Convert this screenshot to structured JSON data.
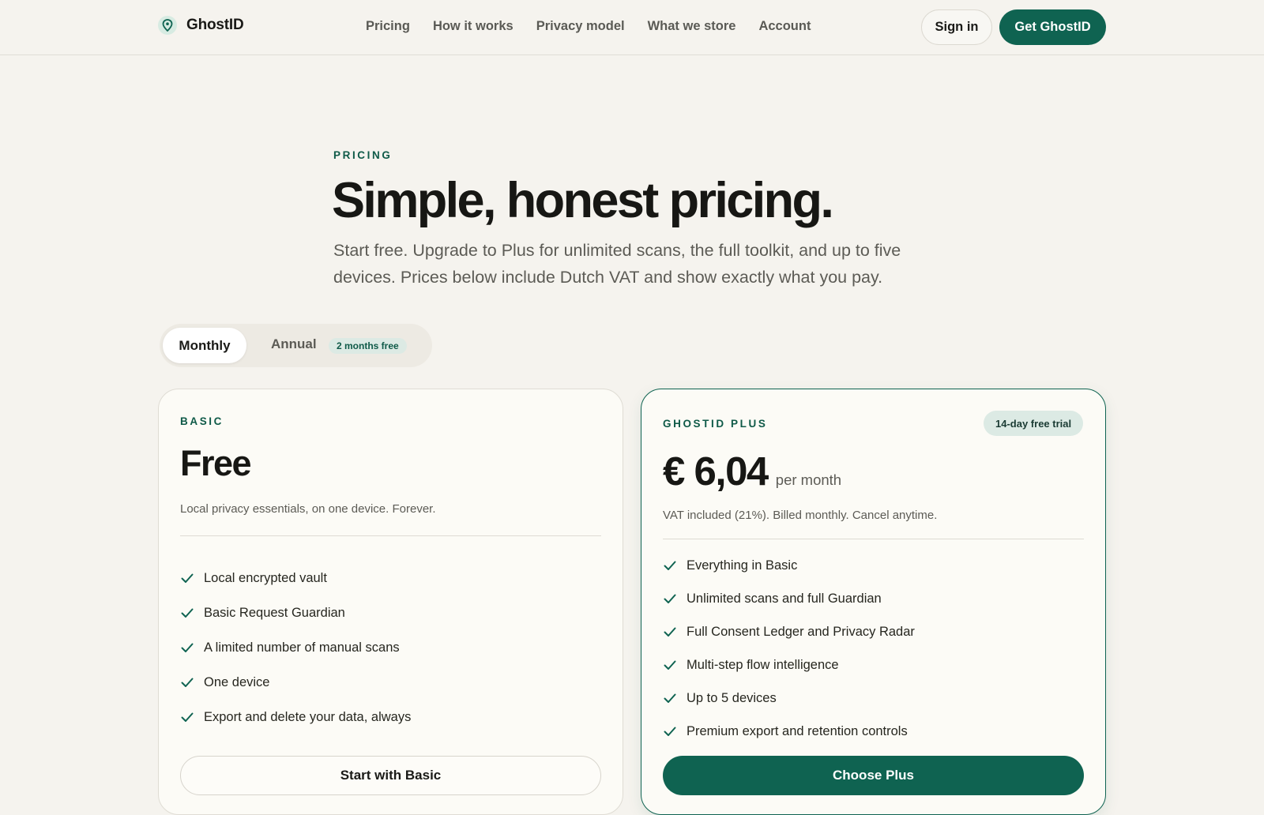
{
  "colors": {
    "accent": "#0f6351",
    "accent_text": "#0f5a48",
    "background": "#f5f3ee",
    "card_bg": "#fcfbf6",
    "badge_bg": "#dceae4"
  },
  "nav": {
    "brand_icon": "location-pin-icon",
    "brand": "GhostID",
    "links": [
      "Pricing",
      "How it works",
      "Privacy model",
      "What we store",
      "Account"
    ],
    "signin_label": "Sign in",
    "cta_label": "Get GhostID"
  },
  "hero": {
    "eyebrow": "PRICING",
    "title": "Simple, honest pricing.",
    "subtitle": "Start free. Upgrade to Plus for unlimited scans, the full toolkit, and up to five devices. Prices below include Dutch VAT and show exactly what you pay."
  },
  "billing_toggle": {
    "monthly_label": "Monthly",
    "annual_label": "Annual",
    "annual_badge": "2 months free",
    "selected": "Monthly"
  },
  "plans": {
    "basic": {
      "label": "BASIC",
      "price": "Free",
      "description": "Local privacy essentials, on one device. Forever.",
      "features": [
        "Local encrypted vault",
        "Basic Request Guardian",
        "A limited number of manual scans",
        "One device",
        "Export and delete your data, always"
      ],
      "button_label": "Start with Basic"
    },
    "plus": {
      "label": "GHOSTID PLUS",
      "badge": "14-day free trial",
      "price": "€ 6,04",
      "period": "per month",
      "description": "VAT included (21%). Billed monthly. Cancel anytime.",
      "features": [
        "Everything in Basic",
        "Unlimited scans and full Guardian",
        "Full Consent Ledger and Privacy Radar",
        "Multi-step flow intelligence",
        "Up to 5 devices",
        "Premium export and retention controls"
      ],
      "button_label": "Choose Plus"
    }
  }
}
